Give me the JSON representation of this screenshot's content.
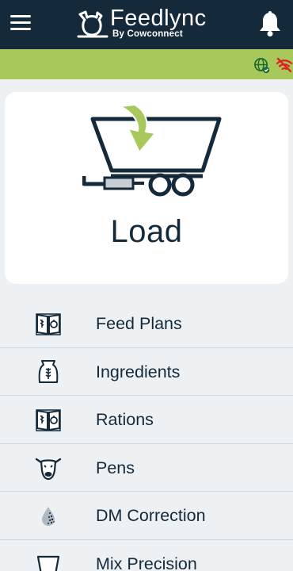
{
  "header": {
    "brand_name": "Feedlync",
    "brand_sub": "By Cowconnect",
    "icons": {
      "menu": "hamburger-menu-icon",
      "notifications": "bell-icon"
    }
  },
  "status": {
    "icons": [
      "globe-check-icon",
      "wifi-off-icon"
    ],
    "colors": {
      "bar": "#a8c85c",
      "wifi_off": "#e02020"
    }
  },
  "load_card": {
    "label": "Load",
    "icon": "trailer-load-icon"
  },
  "menu": [
    {
      "label": "Feed Plans",
      "icon": "recipe-book-icon"
    },
    {
      "label": "Ingredients",
      "icon": "grain-sack-icon"
    },
    {
      "label": "Rations",
      "icon": "recipe-book-icon"
    },
    {
      "label": "Pens",
      "icon": "cow-head-icon"
    },
    {
      "label": "DM Correction",
      "icon": "moisture-drop-icon"
    },
    {
      "label": "Mix Precision",
      "icon": "mixer-icon"
    }
  ],
  "colors": {
    "header": "#142a3b",
    "accent": "#a8c85c",
    "text": "#142a3b",
    "background": "#eef1f4"
  }
}
